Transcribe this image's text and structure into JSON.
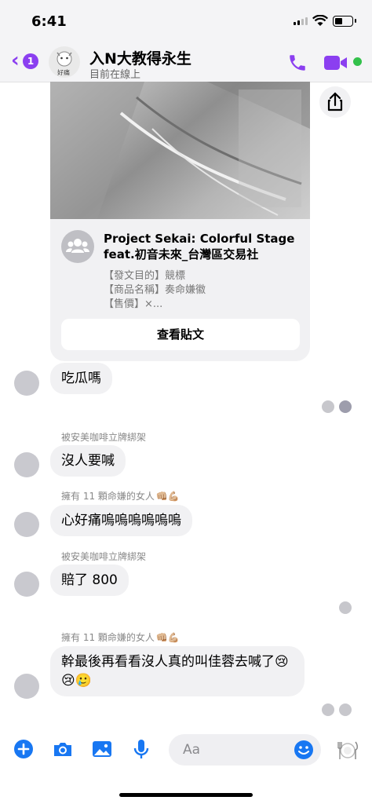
{
  "status_bar": {
    "time": "6:41"
  },
  "header": {
    "back_badge": "1",
    "title": "入N大教得永生",
    "subtitle": "目前在線上",
    "avatar_caption": "好痛"
  },
  "shared_post": {
    "title": "Project Sekai: Colorful Stage feat.初音未來_台灣區交易社",
    "lines": [
      "【發文目的】競標",
      "【商品名稱】奏命嫌徽",
      "【售價】×..."
    ],
    "button_label": "查看貼文"
  },
  "messages": [
    {
      "reply_to": "",
      "text": "吃瓜嗎"
    },
    {
      "reply_to": "被安美咖啡立牌綁架",
      "text": "沒人要喊"
    },
    {
      "reply_to": "擁有 11 顆命嫌的女人",
      "text": "心好痛嗚嗚嗚嗚嗚嗚"
    },
    {
      "reply_to": "被安美咖啡立牌綁架",
      "text": "賠了 800"
    },
    {
      "reply_to": "擁有 11 顆命嫌的女人",
      "text": "幹最後再看看沒人真的叫佳蓉去喊了"
    }
  ],
  "reaction_emoji": "👊🏼💪🏼",
  "crying_emoji": [
    "😢",
    "😢",
    "🥲"
  ],
  "composer": {
    "placeholder": "Aa"
  },
  "icons": {
    "back": "chevron-left-icon",
    "phone": "phone-icon",
    "video": "video-icon",
    "share": "share-icon",
    "plus": "plus-icon",
    "camera": "camera-icon",
    "gallery": "image-icon",
    "mic": "microphone-icon",
    "emoji": "emoji-icon",
    "sticker": "sticker-icon"
  },
  "colors": {
    "accent": "#8b3ff0",
    "composer_blue": "#1877f2",
    "online": "#33c14b",
    "bubble": "#f1f1f3"
  }
}
